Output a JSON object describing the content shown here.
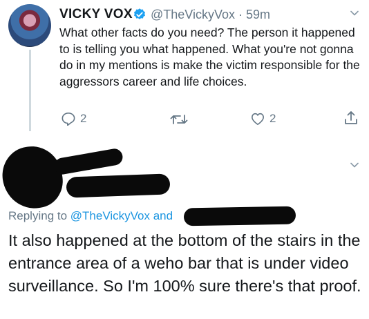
{
  "tweet1": {
    "name": "VICKY VOX",
    "handle": "@TheVickyVox",
    "time": "· 59m",
    "text": "What other facts do you need? The person it happened to is telling you what happened. What you're not gonna do in my mentions is make the victim responsible for the aggressors career and life choices.",
    "reply_count": "2",
    "like_count": "2",
    "verified": true,
    "icons": [
      "reply-icon",
      "retweet-icon",
      "like-icon",
      "share-icon",
      "chevron-down-icon",
      "verified-badge-icon"
    ]
  },
  "tweet2": {
    "replying_prefix": "Replying to ",
    "replying_handle": "@TheVickyVox and",
    "text": "It also happened at the bottom of the stairs in the entrance area of a weho bar that is under video surveillance. So I'm 100% sure there's that proof."
  },
  "colors": {
    "text": "#14171a",
    "secondary": "#657786",
    "link": "#1b95e0",
    "verified": "#1da1f2",
    "redaction": "#0a0a0a"
  }
}
